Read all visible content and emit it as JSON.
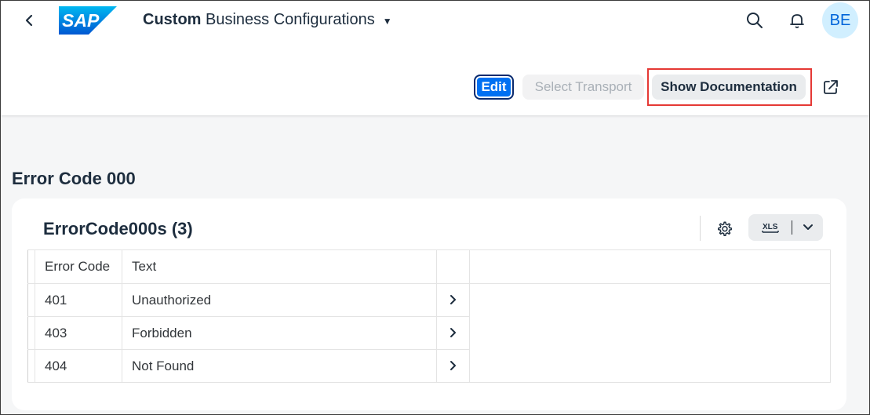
{
  "shell": {
    "logo_text": "SAP",
    "title_bold": "Custom",
    "title_rest": "Business Configurations",
    "avatar_initials": "BE"
  },
  "toolbar": {
    "edit_label": "Edit",
    "select_transport_label": "Select Transport",
    "show_documentation_label": "Show Documentation"
  },
  "section": {
    "title": "Error Code 000"
  },
  "table": {
    "title": "ErrorCode000s (3)",
    "export_label": "XLS",
    "columns": [
      "Error Code",
      "Text"
    ],
    "rows": [
      {
        "code": "401",
        "text": "Unauthorized"
      },
      {
        "code": "403",
        "text": "Forbidden"
      },
      {
        "code": "404",
        "text": "Not Found"
      }
    ]
  },
  "colors": {
    "accent": "#0070f2",
    "avatar_bg": "#d1efff",
    "highlight": "#e53935"
  }
}
